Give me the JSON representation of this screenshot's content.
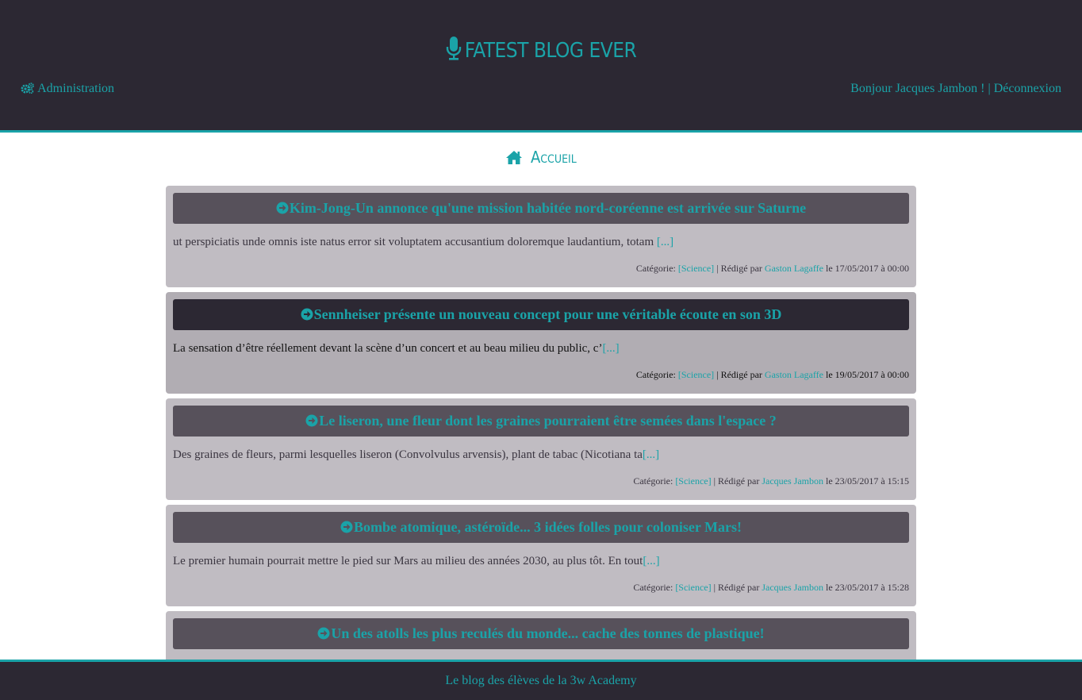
{
  "header": {
    "brand": "FATEST BLOG EVER",
    "admin_label": "Administration",
    "greeting": "Bonjour Jacques Jambon !",
    "separator": "|",
    "logout_label": "Déconnexion"
  },
  "page": {
    "heading": "Accueil"
  },
  "posts": [
    {
      "title": "Kim-Jong-Un annonce qu'une mission habitée nord-coréenne est arrivée sur Saturne",
      "excerpt": "ut perspiciatis unde omnis iste natus error sit voluptatem accusantium doloremque laudantium, totam ",
      "more": "[...]",
      "category_label": "Catégorie:",
      "category": "[Science]",
      "author_label": "| Rédigé par",
      "author": "Gaston Lagaffe",
      "date": "le 17/05/2017 à 00:00"
    },
    {
      "title": "Sennheiser présente un nouveau concept pour une véritable écoute en son 3D",
      "excerpt": "La sensation d’être réellement devant la scène d’un concert et au beau milieu du public, c’",
      "more": "[...]",
      "category_label": "Catégorie:",
      "category": "[Science]",
      "author_label": "| Rédigé par",
      "author": "Gaston Lagaffe",
      "date": "le 19/05/2017 à 00:00"
    },
    {
      "title": "Le liseron, une fleur dont les graines pourraient être semées dans l'espace ?",
      "excerpt": "Des graines de fleurs, parmi lesquelles liseron (Convolvulus arvensis), plant de tabac (Nicotiana ta",
      "more": "[...]",
      "category_label": "Catégorie:",
      "category": "[Science]",
      "author_label": "| Rédigé par",
      "author": "Jacques Jambon",
      "date": "le 23/05/2017 à 15:15"
    },
    {
      "title": "Bombe atomique, astéroïde... 3 idées folles pour coloniser Mars!",
      "excerpt": "Le premier humain pourrait mettre le pied sur Mars au milieu des années 2030, au plus tôt. En tout",
      "more": "[...]",
      "category_label": "Catégorie:",
      "category": "[Science]",
      "author_label": "| Rédigé par",
      "author": "Jacques Jambon",
      "date": "le 23/05/2017 à 15:28"
    },
    {
      "title": "Un des atolls les plus reculés du monde... cache des tonnes de plastique!"
    }
  ],
  "footer": {
    "text": "Le blog des élèves de la 3w Academy"
  },
  "colors": {
    "accent": "#1aa3a8",
    "dark": "#2c2833",
    "card": "#c0bcc2",
    "card_title": "#57515b"
  }
}
